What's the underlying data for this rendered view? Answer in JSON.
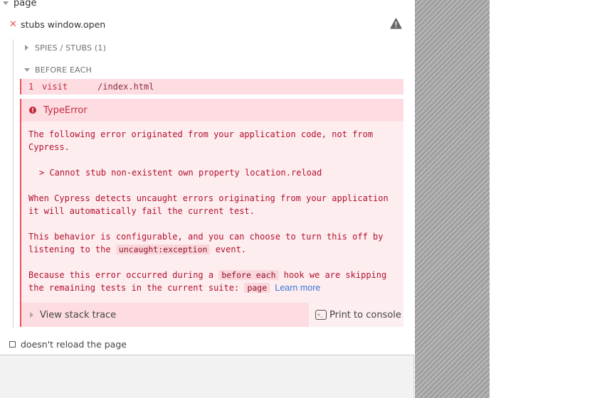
{
  "suite": {
    "title": "page"
  },
  "test": {
    "title": "stubs window.open",
    "state_icon": "x-icon",
    "warning_icon": "warning-triangle-icon"
  },
  "sections": {
    "spies": "SPIES / STUBS (1)",
    "before_each": "BEFORE EACH"
  },
  "command": {
    "number": "1",
    "name": "visit",
    "message": "/index.html"
  },
  "error": {
    "name": "TypeError",
    "p1": "The following error originated from your application code, not from Cypress.",
    "p2": "> Cannot stub non-existent own property location.reload",
    "p3": "When Cypress detects uncaught errors originating from your application it will automatically fail the current test.",
    "p4_before": "This behavior is configurable, and you can choose to turn this off by listening to the",
    "p4_code": "uncaught:exception",
    "p4_after": "event.",
    "p5_before": "Because this error occurred during a",
    "p5_code1": "before each",
    "p5_middle": "hook we are skipping the remaining tests in the current suite:",
    "p5_code2": "page",
    "learn_more": "Learn more",
    "view_stack_trace": "View stack trace",
    "print_to_console": "Print to console",
    "terminal_icon_text": ">_"
  },
  "pending_test": {
    "title": "doesn't reload the page"
  },
  "colors": {
    "failed": "#e94f5f",
    "error_text": "#b3102e",
    "error_bg": "#fdedef",
    "link": "#3a76d8"
  }
}
